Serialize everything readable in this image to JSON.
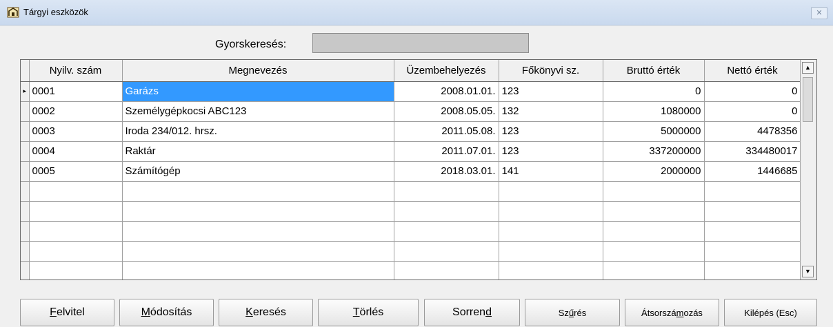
{
  "window": {
    "title": "Tárgyi eszközök",
    "close_icon": "close-icon"
  },
  "search": {
    "label": "Gyorskeresés:",
    "value": ""
  },
  "table": {
    "columns": [
      "Nyilv. szám",
      "Megnevezés",
      "Üzembehelyezés",
      "Főkönyvi sz.",
      "Bruttó érték",
      "Nettó érték"
    ],
    "rows": [
      [
        "0001",
        "Garázs",
        "2008.01.01.",
        "123",
        "0",
        "0"
      ],
      [
        "0002",
        "Személygépkocsi ABC123",
        "2008.05.05.",
        "132",
        "1080000",
        "0"
      ],
      [
        "0003",
        "Iroda 234/012. hrsz.",
        "2011.05.08.",
        "123",
        "5000000",
        "4478356"
      ],
      [
        "0004",
        "Raktár",
        "2011.07.01.",
        "123",
        "337200000",
        "334480017"
      ],
      [
        "0005",
        "Számítógép",
        "2018.03.01.",
        "141",
        "2000000",
        "1446685"
      ]
    ],
    "current_row_marker": "▸",
    "selection_color": "#3399ff"
  },
  "buttons": {
    "felvitel": {
      "pre": "",
      "key": "F",
      "post": "elvitel"
    },
    "modositas": {
      "pre": "",
      "key": "M",
      "post": "ódosítás"
    },
    "kereses": {
      "pre": "",
      "key": "K",
      "post": "eresés"
    },
    "torles": {
      "pre": "",
      "key": "T",
      "post": "örlés"
    },
    "sorrend": {
      "pre": "Sorren",
      "key": "d",
      "post": ""
    },
    "szures": {
      "pre": "Sz",
      "key": "ű",
      "post": "rés"
    },
    "atsorszamozas": {
      "pre": "Átsorszá",
      "key": "m",
      "post": "ozás"
    },
    "kilepes": {
      "pre": "Kilépés (Esc)",
      "key": "",
      "post": ""
    }
  }
}
